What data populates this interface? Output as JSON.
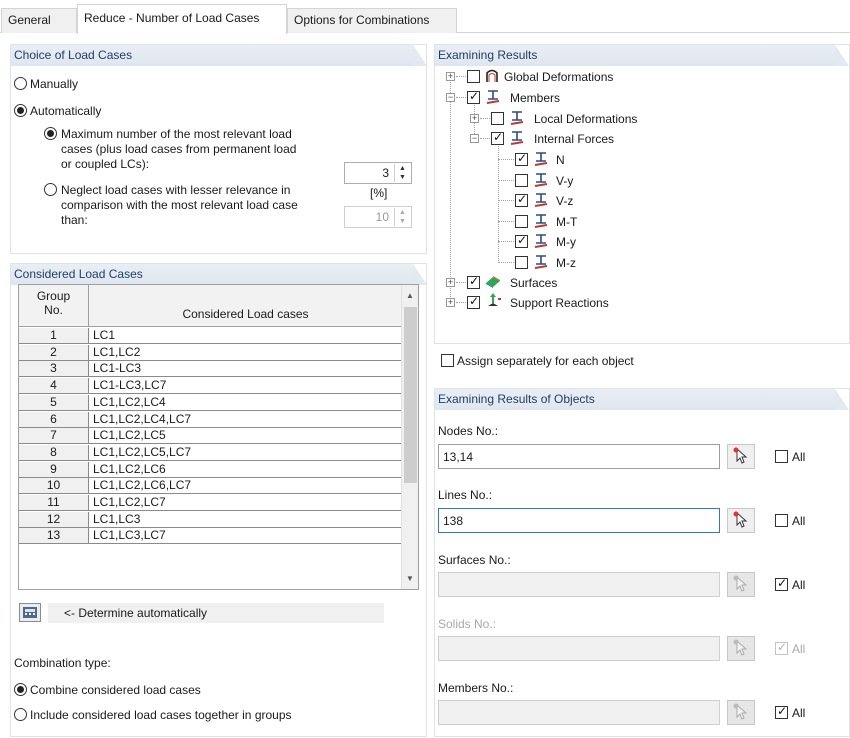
{
  "tabs": [
    {
      "label": "General"
    },
    {
      "label": "Reduce - Number of Load Cases"
    },
    {
      "label": "Options for Combinations"
    }
  ],
  "choice": {
    "header": "Choice of Load Cases",
    "manually": "Manually",
    "automatically": "Automatically",
    "max_label_1": "Maximum number of the most relevant load",
    "max_label_2": "cases (plus load cases from permanent load",
    "max_label_3": "or coupled LCs):",
    "max_value": "3",
    "neglect_label_1": "Neglect load cases with lesser relevance in",
    "neglect_label_2": "comparison with the most relevant load case",
    "neglect_label_3": "than:",
    "unit": "[%]",
    "neglect_value": "10"
  },
  "considered": {
    "header": "Considered Load Cases",
    "col_group_1": "Group",
    "col_group_2": "No.",
    "col_lc": "Considered Load cases",
    "rows": [
      {
        "no": "1",
        "lc": "LC1"
      },
      {
        "no": "2",
        "lc": "LC1,LC2"
      },
      {
        "no": "3",
        "lc": "LC1-LC3"
      },
      {
        "no": "4",
        "lc": "LC1-LC3,LC7"
      },
      {
        "no": "5",
        "lc": "LC1,LC2,LC4"
      },
      {
        "no": "6",
        "lc": "LC1,LC2,LC4,LC7"
      },
      {
        "no": "7",
        "lc": "LC1,LC2,LC5"
      },
      {
        "no": "8",
        "lc": "LC1,LC2,LC5,LC7"
      },
      {
        "no": "9",
        "lc": "LC1,LC2,LC6"
      },
      {
        "no": "10",
        "lc": "LC1,LC2,LC6,LC7"
      },
      {
        "no": "11",
        "lc": "LC1,LC2,LC7"
      },
      {
        "no": "12",
        "lc": "LC1,LC3"
      },
      {
        "no": "13",
        "lc": "LC1,LC3,LC7"
      }
    ],
    "determine_label": "<- Determine automatically",
    "combination_type": "Combination type:",
    "combine": "Combine considered load cases",
    "include": "Include considered load cases together in groups"
  },
  "examining": {
    "header": "Examining Results",
    "tree": {
      "global_def": "Global Deformations",
      "members": "Members",
      "local_def": "Local Deformations",
      "internal_forces": "Internal Forces",
      "n": "N",
      "vy": "V-y",
      "vz": "V-z",
      "mt": "M-T",
      "my": "M-y",
      "mz": "M-z",
      "surfaces": "Surfaces",
      "support_reactions": "Support Reactions"
    },
    "assign_separately": "Assign separately for each object"
  },
  "objects": {
    "header": "Examining Results of Objects",
    "nodes_label": "Nodes No.:",
    "nodes_value": "13,14",
    "lines_label": "Lines No.:",
    "lines_value": "138",
    "surfaces_label": "Surfaces No.:",
    "solids_label": "Solids No.:",
    "members_label": "Members No.:",
    "all": "All"
  },
  "colors": {
    "header_text": "#1f3f66",
    "focus_border": "#2f77d2"
  }
}
